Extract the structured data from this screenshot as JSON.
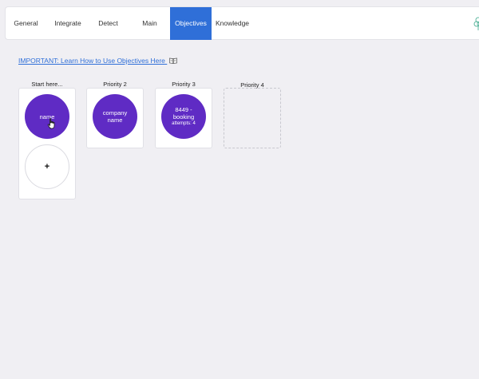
{
  "nav": {
    "tabs": [
      {
        "label": "General"
      },
      {
        "label": "Integrate"
      },
      {
        "label": "Detect"
      },
      {
        "label": "Main"
      },
      {
        "label": "Objectives"
      },
      {
        "label": "Knowledge"
      }
    ],
    "active_tab": "Objectives",
    "logo_icon": "brain-tree-icon"
  },
  "guide_link": {
    "text": "IMPORTANT:  Learn How to Use Objectives Here",
    "icon": "book-icon"
  },
  "columns": [
    {
      "label": "Start here...",
      "nodes": [
        {
          "line1": "name",
          "line2": "",
          "sub": ""
        }
      ],
      "has_add": true,
      "add_label": "+"
    },
    {
      "label": "Priority 2",
      "nodes": [
        {
          "line1": "company",
          "line2": "name",
          "sub": ""
        }
      ]
    },
    {
      "label": "Priority 3",
      "nodes": [
        {
          "line1": "8449 -",
          "line2": "booking",
          "sub": "attempts: 4"
        }
      ]
    },
    {
      "label": "Priority 4",
      "nodes": []
    }
  ],
  "colors": {
    "accent": "#2f6fd8",
    "node": "#5f2bc4",
    "background": "#f0eff3"
  }
}
